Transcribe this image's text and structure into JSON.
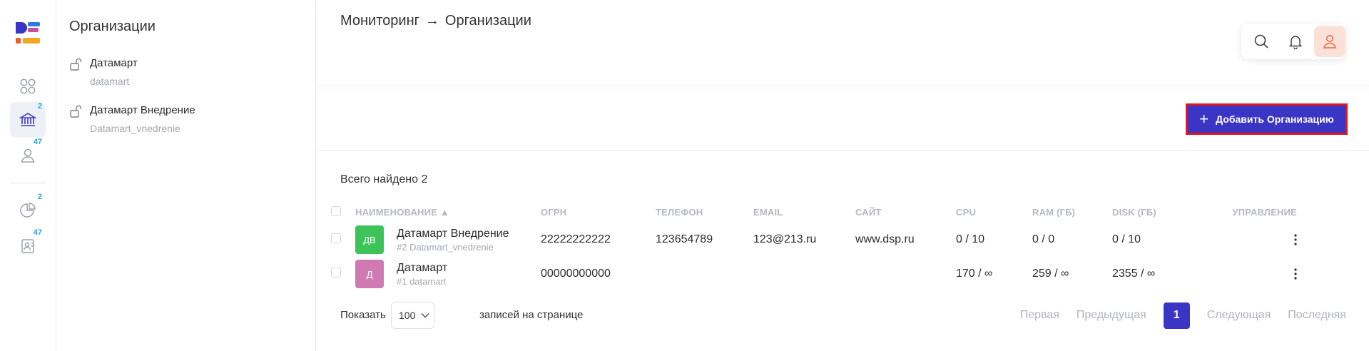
{
  "rail": {
    "items": [
      {
        "icon": "apps-grid-icon",
        "badge": ""
      },
      {
        "icon": "bank-icon",
        "badge": "2"
      },
      {
        "icon": "user-icon",
        "badge": "47"
      },
      {
        "icon": "pie-chart-icon",
        "badge": "2"
      },
      {
        "icon": "contact-card-icon",
        "badge": "47"
      }
    ]
  },
  "org_panel": {
    "title": "Организации",
    "items": [
      {
        "name": "Датамарт",
        "code": "datamart"
      },
      {
        "name": "Датамарт Внедрение",
        "code": "Datamart_vnedrenie"
      }
    ]
  },
  "header": {
    "crumb_parent": "Мониторинг",
    "crumb_sep": "→",
    "crumb_current": "Организации"
  },
  "toolbar": {
    "add_label": "Добавить Организацию"
  },
  "summary": {
    "total_text": "Всего найдено 2"
  },
  "table": {
    "columns": {
      "name": "НАИМЕНОВАНИЕ ▲",
      "ogrn": "ОГРН",
      "phone": "ТЕЛЕФОН",
      "email": "EMAIL",
      "site": "САЙТ",
      "cpu": "CPU",
      "ram": "RAM (ГБ)",
      "disk": "DISK (ГБ)",
      "manage": "УПРАВЛЕНИЕ"
    },
    "rows": [
      {
        "initials": "ДВ",
        "avatar_color": "#3cc45b",
        "name": "Датамарт Внедрение",
        "sub": "#2 Datamart_vnedrenie",
        "ogrn": "22222222222",
        "phone": "123654789",
        "email": "123@213.ru",
        "site": "www.dsp.ru",
        "cpu": "0 / 10",
        "ram": "0 / 0",
        "disk": "0 / 10"
      },
      {
        "initials": "Д",
        "avatar_color": "#d07ab3",
        "name": "Датамарт",
        "sub": "#1 datamart",
        "ogrn": "00000000000",
        "phone": "",
        "email": "",
        "site": "",
        "cpu": "170 / ∞",
        "ram": "259 / ∞",
        "disk": "2355 / ∞"
      }
    ]
  },
  "pagination": {
    "show_label": "Показать",
    "page_size": "100",
    "per_page_label": "записей на странице",
    "first": "Первая",
    "prev": "Предыдущая",
    "current": "1",
    "next": "Следующая",
    "last": "Последняя"
  },
  "colors": {
    "accent": "#3a35c4",
    "highlight_border": "#e0161f",
    "badge": "#2aa3d8"
  }
}
